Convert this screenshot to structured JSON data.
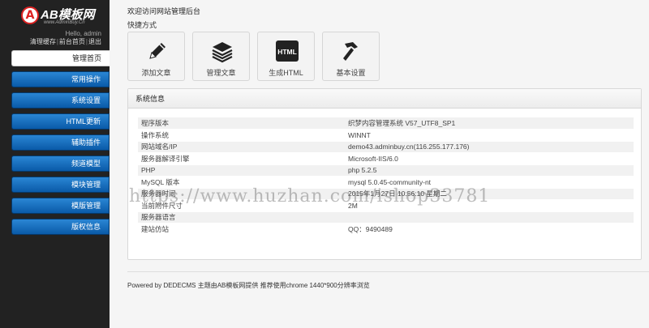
{
  "sidebar": {
    "logo_letter": "A",
    "logo_text": "AB模板网",
    "logo_sub": "www.AdminBuy.Cn",
    "hello": "Hello, admin",
    "links": [
      "清理缓存",
      "前台首页",
      "退出"
    ],
    "menu": [
      "管理首页",
      "常用操作",
      "系统设置",
      "HTML更新",
      "辅助插件",
      "频道模型",
      "模块管理",
      "模版管理",
      "版权信息"
    ]
  },
  "main": {
    "welcome": "欢迎访问网站管理后台",
    "quick_title": "快捷方式",
    "quick": [
      {
        "label": "添加文章",
        "icon": "pencil-icon"
      },
      {
        "label": "管理文章",
        "icon": "stack-icon"
      },
      {
        "label": "生成HTML",
        "icon": "html-icon",
        "icon_text": "HTML"
      },
      {
        "label": "基本设置",
        "icon": "hammer-icon"
      }
    ],
    "panel_title": "系统信息",
    "rows": [
      {
        "k": "程序版本",
        "v": "织梦内容管理系统 V57_UTF8_SP1"
      },
      {
        "k": "操作系统",
        "v": "WINNT"
      },
      {
        "k": "网站域名/IP",
        "v": "demo43.adminbuy.cn(116.255.177.176)"
      },
      {
        "k": "服务器解译引擎",
        "v": "Microsoft-IIS/6.0"
      },
      {
        "k": "PHP",
        "v": "php 5.2.5"
      },
      {
        "k": "MySQL 版本",
        "v": "mysql 5.0.45-community-nt"
      },
      {
        "k": "服务器时间",
        "v": "2015年1月27日 10:56:10 星期二"
      },
      {
        "k": "当前附件尺寸",
        "v": "2M"
      },
      {
        "k": "服务器语言",
        "v": ""
      },
      {
        "k": "建站仿站",
        "v": "QQ：9490489"
      }
    ],
    "footer": "Powered by DEDECMS 主题由AB模板网提供 推荐使用chrome 1440*900分辨率浏览"
  },
  "watermark": "https://www.huzhan.com/ishop33781"
}
